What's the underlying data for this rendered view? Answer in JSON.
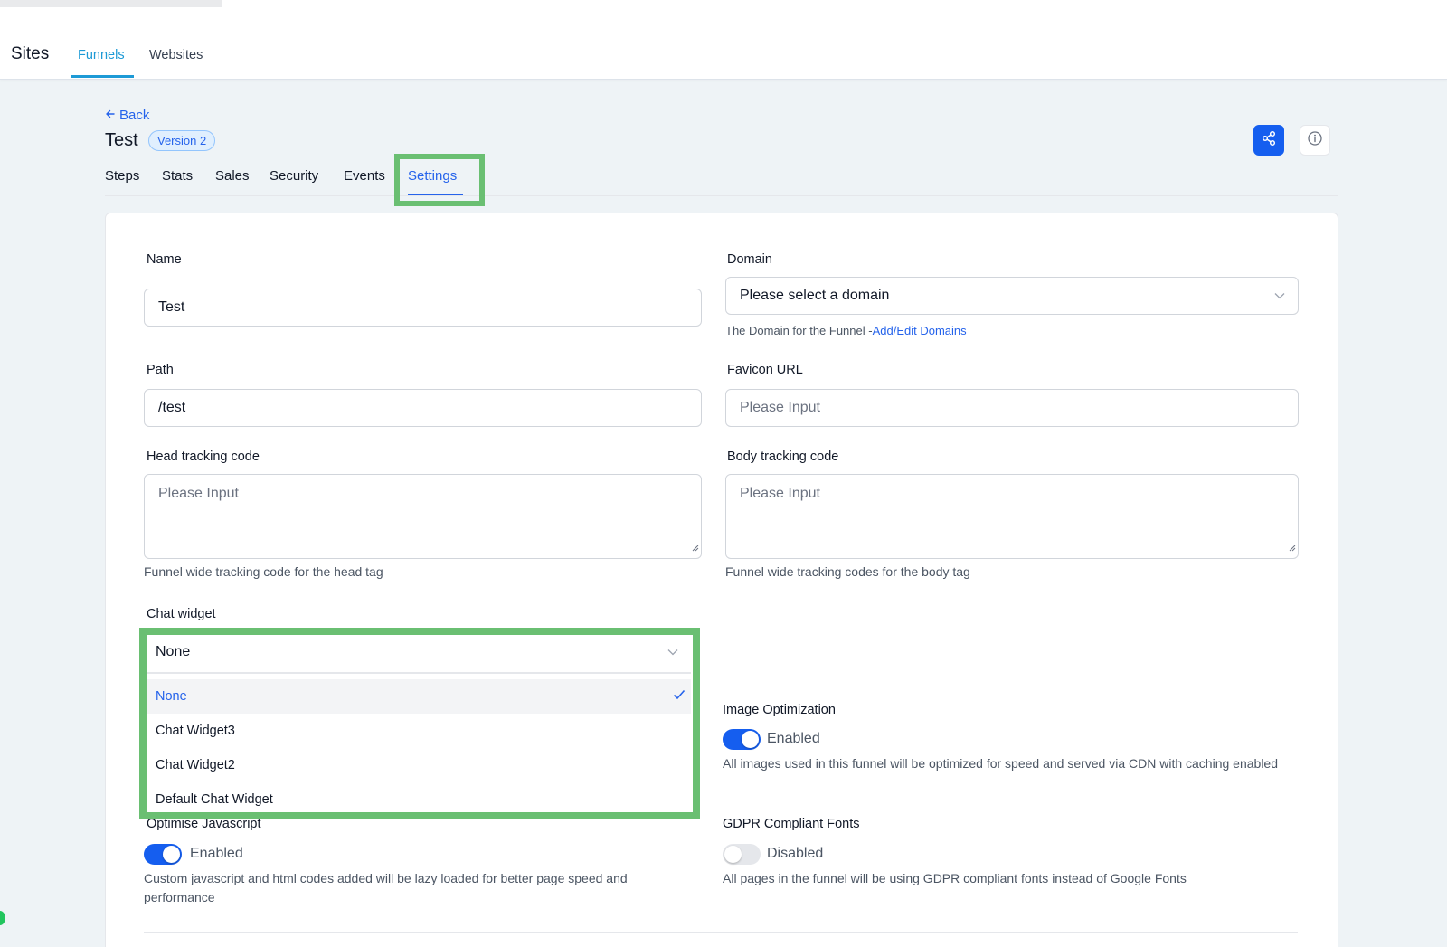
{
  "header": {
    "title": "Sites",
    "tabs": [
      {
        "label": "Funnels",
        "active": true
      },
      {
        "label": "Websites",
        "active": false
      }
    ]
  },
  "page": {
    "back_label": "Back",
    "title": "Test",
    "version_badge": "Version 2",
    "tabs": [
      {
        "label": "Steps"
      },
      {
        "label": "Stats"
      },
      {
        "label": "Sales"
      },
      {
        "label": "Security"
      },
      {
        "label": "Events"
      },
      {
        "label": "Settings",
        "active": true
      }
    ]
  },
  "form": {
    "name": {
      "label": "Name",
      "value": "Test"
    },
    "domain": {
      "label": "Domain",
      "placeholder": "Please select a domain",
      "help_text": "The Domain for the Funnel -",
      "help_link": "Add/Edit Domains"
    },
    "path": {
      "label": "Path",
      "value": "/test"
    },
    "favicon": {
      "label": "Favicon URL",
      "placeholder": "Please Input"
    },
    "head_code": {
      "label": "Head tracking code",
      "placeholder": "Please Input",
      "help_text": "Funnel wide tracking code for the head tag"
    },
    "body_code": {
      "label": "Body tracking code",
      "placeholder": "Please Input",
      "help_text": "Funnel wide tracking codes for the body tag"
    },
    "chat_widget": {
      "label": "Chat widget",
      "value": "None",
      "options": [
        {
          "label": "None",
          "selected": true
        },
        {
          "label": "Chat Widget3"
        },
        {
          "label": "Chat Widget2"
        },
        {
          "label": "Default Chat Widget"
        }
      ]
    },
    "image_optimization": {
      "label": "Image Optimization",
      "state_label": "Enabled",
      "enabled": true,
      "help_text": "All images used in this funnel will be optimized for speed and served via CDN with caching enabled"
    },
    "optimise_js": {
      "label": "Optimise Javascript",
      "state_label": "Enabled",
      "enabled": true,
      "help_text": "Custom javascript and html codes added will be lazy loaded for better page speed and performance"
    },
    "gdpr_fonts": {
      "label": "GDPR Compliant Fonts",
      "state_label": "Disabled",
      "enabled": false,
      "help_text": "All pages in the funnel will be using GDPR compliant fonts instead of Google Fonts"
    }
  },
  "colors": {
    "accent": "#155eef",
    "link": "#2563eb",
    "tab_accent": "#1d9ad6",
    "highlight": "#6abf72"
  },
  "icons": {
    "back": "arrow-left-icon",
    "share": "share-icon",
    "info": "info-icon",
    "chevron": "chevron-down-icon",
    "check": "check-icon"
  }
}
